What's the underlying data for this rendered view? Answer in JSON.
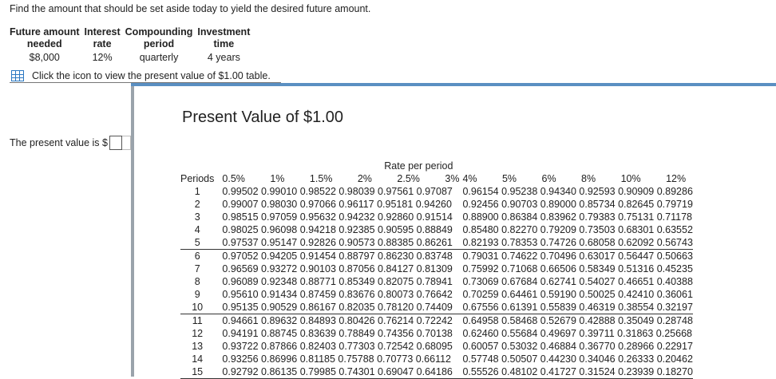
{
  "question": "Find the amount that should be set aside today to yield the desired future amount.",
  "given": {
    "headers": [
      "Future amount\nneeded",
      "Interest\nrate",
      "Compounding\nperiod",
      "Investment\ntime"
    ],
    "values": [
      "$8,000",
      "12%",
      "quarterly",
      "4 years"
    ]
  },
  "table_link": "Click the icon to view the present value of $1.00 table.",
  "answer": {
    "label": "The present value is $",
    "value": ""
  },
  "modal": {
    "title": "Present Value of $1.00",
    "rate_header": "Rate per period",
    "periods_label": "Periods",
    "rates_lower": [
      "0.5%",
      "1%",
      "1.5%",
      "2%",
      "2.5%",
      "3%"
    ],
    "rates_upper": [
      "4%",
      "5%",
      "6%",
      "8%",
      "10%",
      "12%"
    ],
    "rows": [
      {
        "p": "1",
        "lower": "0.99502 0.99010 0.98522 0.98039 0.97561 0.97087",
        "upper": "0.96154 0.95238 0.94340 0.92593 0.90909 0.89286"
      },
      {
        "p": "2",
        "lower": "0.99007 0.98030 0.97066 0.96117 0.95181 0.94260",
        "upper": "0.92456 0.90703 0.89000 0.85734 0.82645 0.79719"
      },
      {
        "p": "3",
        "lower": "0.98515 0.97059 0.95632 0.94232 0.92860 0.91514",
        "upper": "0.88900 0.86384 0.83962 0.79383 0.75131 0.71178"
      },
      {
        "p": "4",
        "lower": "0.98025 0.96098 0.94218 0.92385 0.90595 0.88849",
        "upper": "0.85480 0.82270 0.79209 0.73503 0.68301 0.63552"
      },
      {
        "p": "5",
        "lower": "0.97537 0.95147 0.92826 0.90573 0.88385 0.86261",
        "upper": "0.82193 0.78353 0.74726 0.68058 0.62092 0.56743"
      },
      {
        "p": "6",
        "lower": "0.97052 0.94205 0.91454 0.88797 0.86230 0.83748",
        "upper": "0.79031 0.74622 0.70496 0.63017 0.56447 0.50663"
      },
      {
        "p": "7",
        "lower": "0.96569 0.93272 0.90103 0.87056 0.84127 0.81309",
        "upper": "0.75992 0.71068 0.66506 0.58349 0.51316 0.45235"
      },
      {
        "p": "8",
        "lower": "0.96089 0.92348 0.88771 0.85349 0.82075 0.78941",
        "upper": "0.73069 0.67684 0.62741 0.54027 0.46651 0.40388"
      },
      {
        "p": "9",
        "lower": "0.95610 0.91434 0.87459 0.83676 0.80073 0.76642",
        "upper": "0.70259 0.64461 0.59190 0.50025 0.42410 0.36061"
      },
      {
        "p": "10",
        "lower": "0.95135 0.90529 0.86167 0.82035 0.78120 0.74409",
        "upper": "0.67556 0.61391 0.55839 0.46319 0.38554 0.32197"
      },
      {
        "p": "11",
        "lower": "0.94661 0.89632 0.84893 0.80426 0.76214 0.72242",
        "upper": "0.64958 0.58468 0.52679 0.42888 0.35049 0.28748"
      },
      {
        "p": "12",
        "lower": "0.94191 0.88745 0.83639 0.78849 0.74356 0.70138",
        "upper": "0.62460 0.55684 0.49697 0.39711 0.31863 0.25668"
      },
      {
        "p": "13",
        "lower": "0.93722 0.87866 0.82403 0.77303 0.72542 0.68095",
        "upper": "0.60057 0.53032 0.46884 0.36770 0.28966 0.22917"
      },
      {
        "p": "14",
        "lower": "0.93256 0.86996 0.81185 0.75788 0.70773 0.66112",
        "upper": "0.57748 0.50507 0.44230 0.34046 0.26333 0.20462"
      },
      {
        "p": "15",
        "lower": "0.92792 0.86135 0.79985 0.74301 0.69047 0.64186",
        "upper": "0.55526 0.48102 0.41727 0.31524 0.23939 0.18270"
      }
    ]
  }
}
